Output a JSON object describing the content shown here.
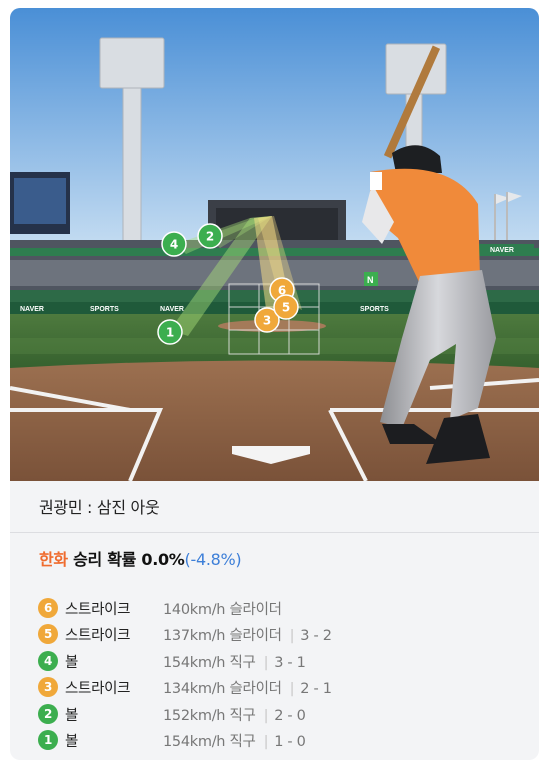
{
  "result": {
    "text": "권광민 : 삼진 아웃"
  },
  "win_probability": {
    "team": "한화",
    "label": "승리 확률",
    "value": "0.0%",
    "delta": "(-4.8%)"
  },
  "scene": {
    "boards": {
      "naver": "NAVER",
      "sports": "SPORTS",
      "letter": "N"
    }
  },
  "pitches": [
    {
      "number": "6",
      "type": "스트라이크",
      "kind": "strike",
      "speed": "140km/h",
      "pitch": "슬라이더",
      "count": ""
    },
    {
      "number": "5",
      "type": "스트라이크",
      "kind": "strike",
      "speed": "137km/h",
      "pitch": "슬라이더",
      "count": "3 - 2"
    },
    {
      "number": "4",
      "type": "볼",
      "kind": "ball",
      "speed": "154km/h",
      "pitch": "직구",
      "count": "3 - 1"
    },
    {
      "number": "3",
      "type": "스트라이크",
      "kind": "strike",
      "speed": "134km/h",
      "pitch": "슬라이더",
      "count": "2 - 1"
    },
    {
      "number": "2",
      "type": "볼",
      "kind": "ball",
      "speed": "152km/h",
      "pitch": "직구",
      "count": "2 - 0"
    },
    {
      "number": "1",
      "type": "볼",
      "kind": "ball",
      "speed": "154km/h",
      "pitch": "직구",
      "count": "1 - 0"
    }
  ],
  "colors": {
    "strike": "#f0a83a",
    "ball": "#3cae4f",
    "team": "#ef6c2f",
    "delta": "#3d7fd8"
  }
}
